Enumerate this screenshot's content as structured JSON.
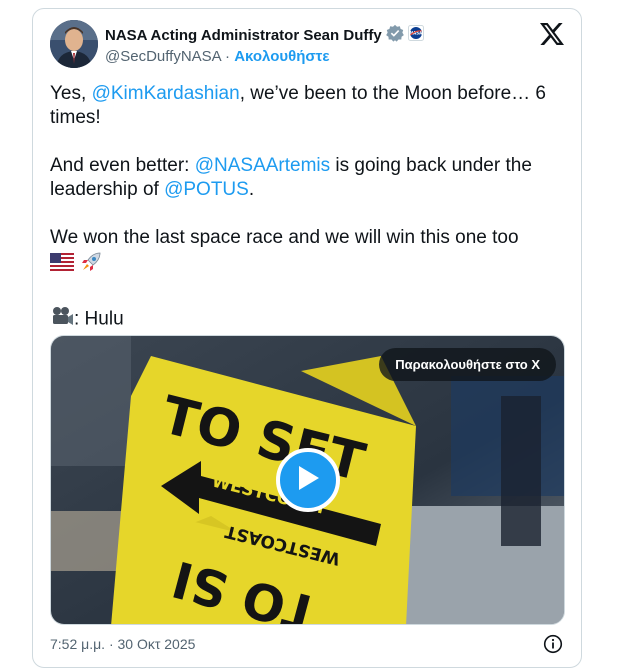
{
  "author": {
    "name": "NASA Acting Administrator Sean Duffy",
    "handle": "@SecDuffyNASA",
    "separator": "·",
    "follow_label": "Ακολουθήστε",
    "badge_text": "NASA"
  },
  "tweet": {
    "line1_pre": "Yes, ",
    "line1_mention": "@KimKardashian",
    "line1_post": ", we’ve been to the Moon before… 6 times!",
    "line2_pre": "And even better: ",
    "line2_mention1": "@NASAArtemis",
    "line2_mid": " is going back under the leadership of ",
    "line2_mention2": "@POTUS",
    "line2_post": ".",
    "line3": "We won the last space race and we will win this one too",
    "line4_post": ": Hulu"
  },
  "media": {
    "watch_label": "Παρακολουθήστε στο X",
    "sign_text_main": "TO SET",
    "sign_text_arrow": "WESTCOAST",
    "sign_text_bottom": "TO SI"
  },
  "footer": {
    "timestamp": "7:52 μ.μ. · 30 Οκτ 2025"
  },
  "colors": {
    "accent": "#1d9bf0",
    "text": "#0f1419",
    "muted": "#536471",
    "border": "#cfd9de",
    "sign_yellow": "#e6d62a"
  },
  "icons": [
    "verified-icon",
    "nasa-logo-icon",
    "x-logo-icon",
    "us-flag-icon",
    "rocket-icon",
    "movie-camera-icon",
    "play-icon",
    "info-icon"
  ]
}
